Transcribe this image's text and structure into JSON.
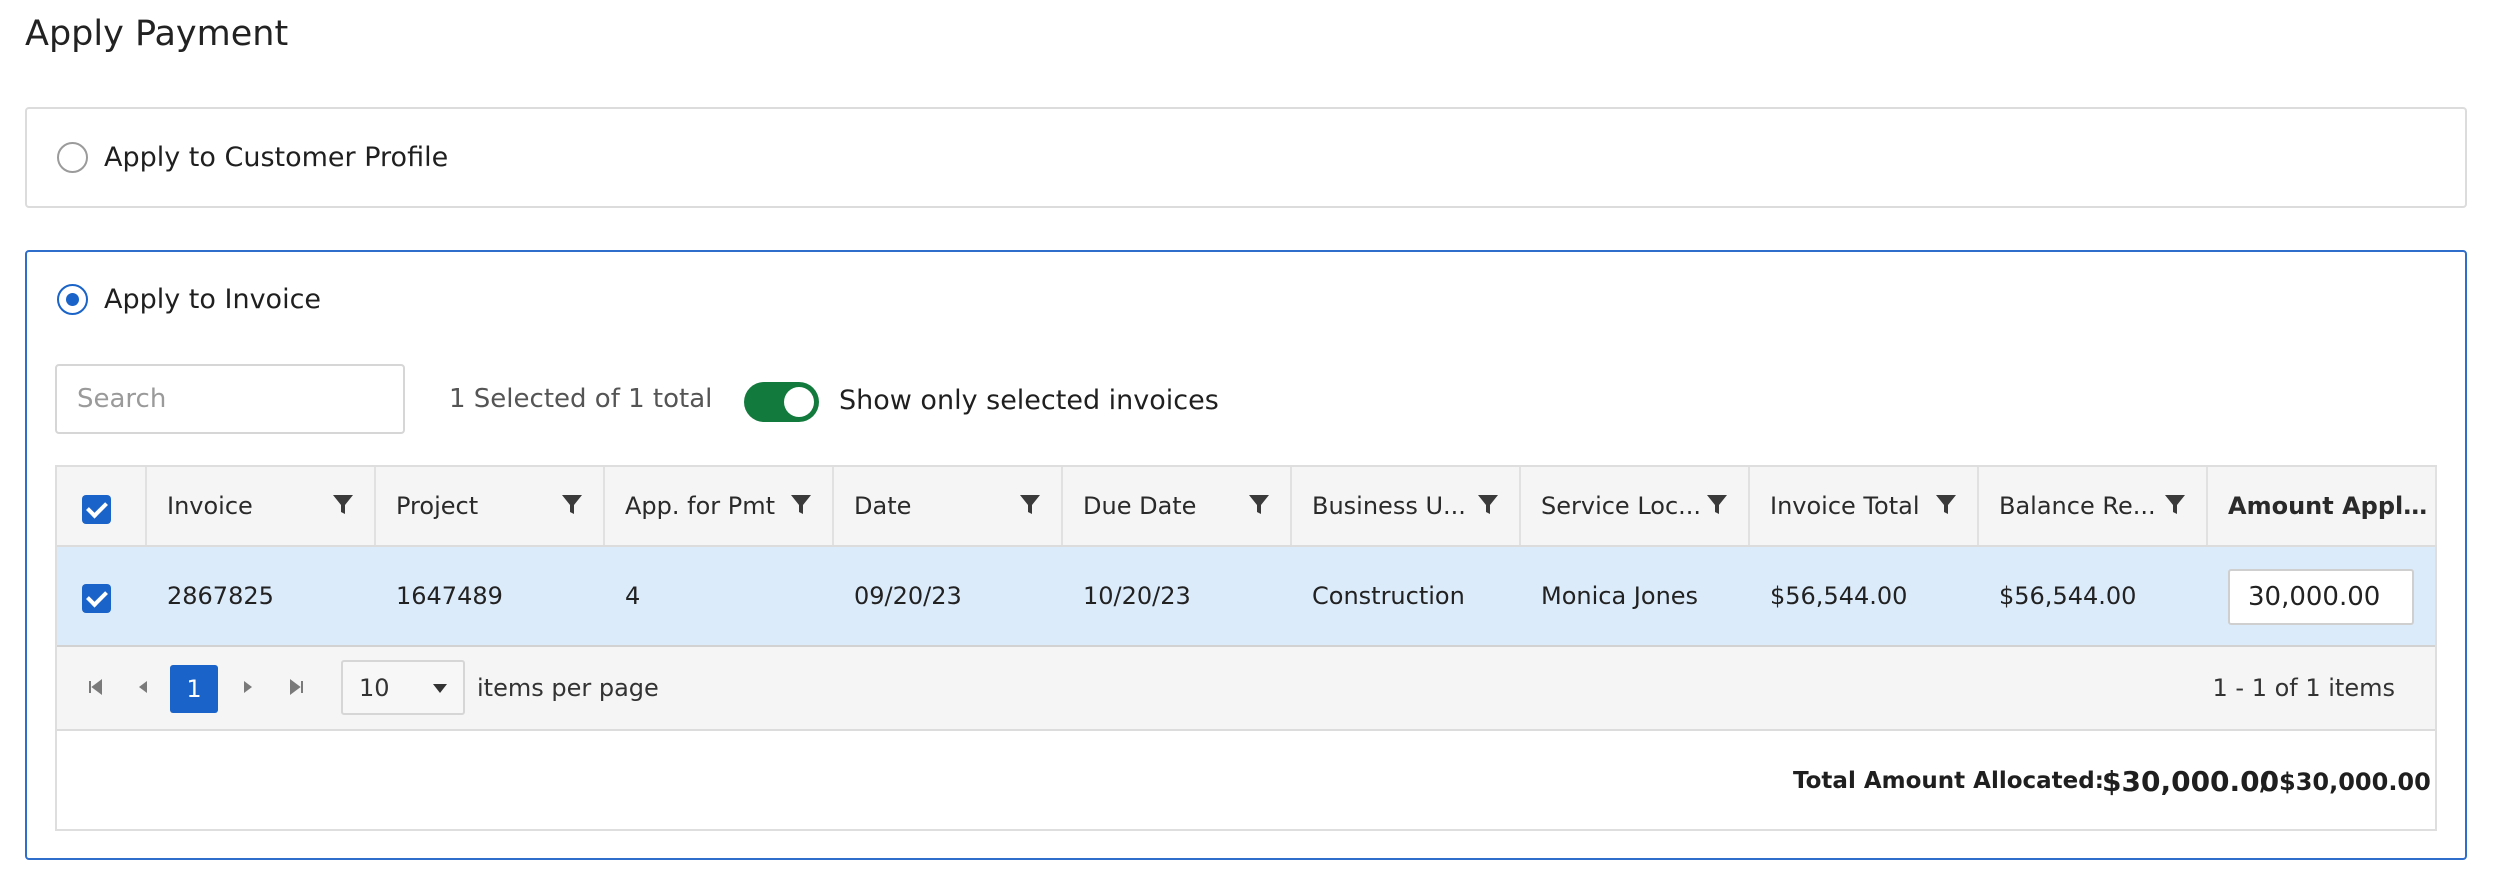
{
  "page": {
    "title": "Apply Payment"
  },
  "profile_option": {
    "label": "Apply to Customer Profile",
    "selected": false
  },
  "invoice_option": {
    "label": "Apply to Invoice",
    "selected": true
  },
  "toolbar": {
    "search_placeholder": "Search",
    "selected_count": "1 Selected of 1 total",
    "toggle_label": "Show only selected invoices",
    "toggle_on": true
  },
  "grid": {
    "columns": [
      {
        "key": "invoice",
        "label": "Invoice",
        "filterable": true
      },
      {
        "key": "project",
        "label": "Project",
        "filterable": true
      },
      {
        "key": "app_for_pmt",
        "label": "App. for Pmt",
        "filterable": true
      },
      {
        "key": "date",
        "label": "Date",
        "filterable": true
      },
      {
        "key": "due_date",
        "label": "Due Date",
        "filterable": true
      },
      {
        "key": "business_unit",
        "label": "Business U...",
        "filterable": true
      },
      {
        "key": "service_location",
        "label": "Service Loc...",
        "filterable": true
      },
      {
        "key": "invoice_total",
        "label": "Invoice Total",
        "filterable": true
      },
      {
        "key": "balance_remaining",
        "label": "Balance Re...",
        "filterable": true
      },
      {
        "key": "amount_applied",
        "label": "Amount Applied",
        "filterable": false
      }
    ],
    "rows": [
      {
        "selected": true,
        "invoice": "2867825",
        "project": "1647489",
        "app_for_pmt": "4",
        "date": "09/20/23",
        "due_date": "10/20/23",
        "business_unit": "Construction",
        "service_location": "Monica Jones",
        "invoice_total": "$56,544.00",
        "balance_remaining": "$56,544.00",
        "amount_applied": "30,000.00"
      }
    ]
  },
  "pager": {
    "current_page": "1",
    "page_size": "10",
    "per_page_label": "items per page",
    "info": "1 - 1 of 1 items"
  },
  "footer": {
    "total_label": "Total Amount Allocated:",
    "total_allocated": "$30,000.00",
    "separator": "/",
    "total_available": "$30,000.00"
  },
  "colors": {
    "accent": "#1a63c8",
    "toggle_on": "#137a3d",
    "selected_row": "#dcebfa",
    "active_panel_border": "#2f6fcb"
  }
}
